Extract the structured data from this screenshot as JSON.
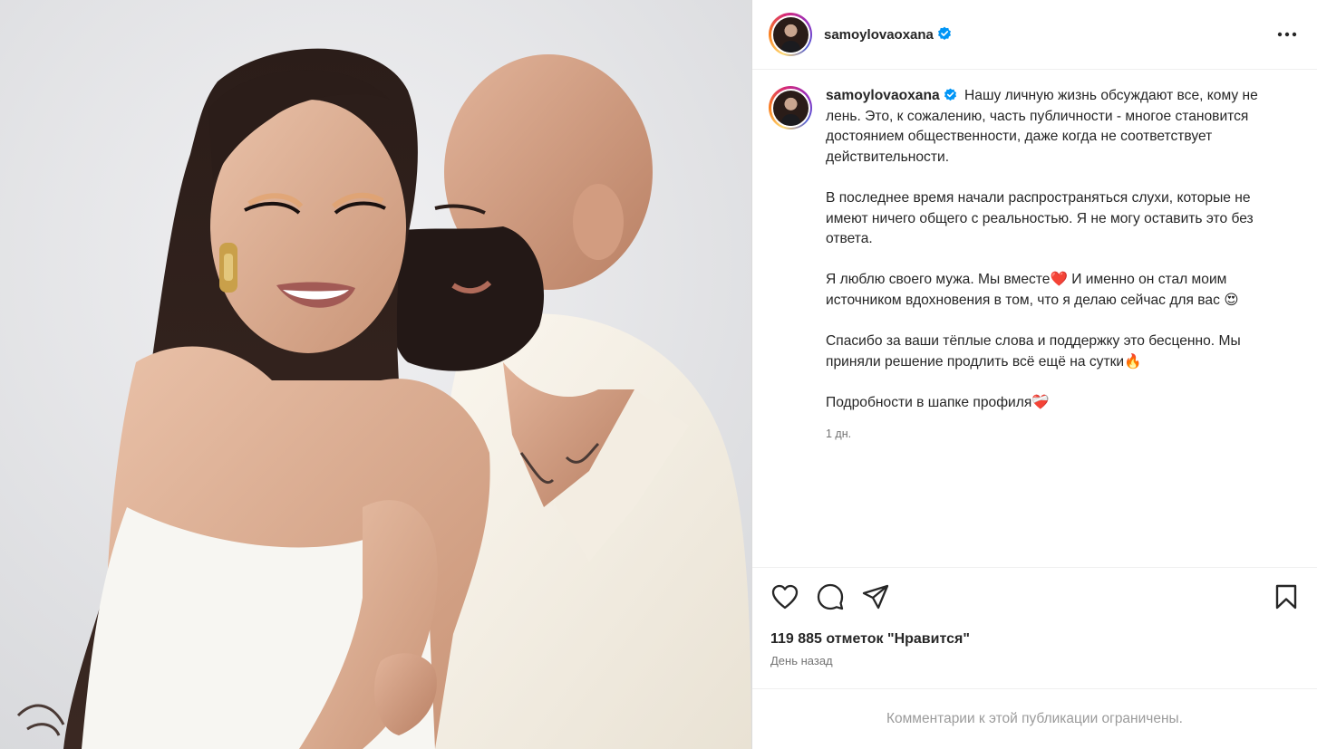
{
  "post": {
    "author": {
      "username": "samoylovaoxana",
      "verified": true,
      "avatar_icon": "profile-photo"
    },
    "caption": {
      "username": "samoylovaoxana",
      "paragraphs": [
        "Нашу личную жизнь обсуждают все, кому не лень. Это, к сожалению, часть публичности - многое становится достоянием общественности, даже когда не соответствует действительности.",
        "В последнее время начали распространяться слухи, которые не имеют ничего общего с реальностью. Я не могу оставить это без ответа.",
        "Я люблю своего мужа. Мы вместе❤️ И именно он стал моим источником вдохновения в том, что я делаю сейчас для вас 😍",
        "Спасибо за ваши тёплые слова и поддержку это бесценно. Мы приняли решение продлить всё ещё на сутки🔥",
        "Подробности в шапке профиля❤️‍🩹"
      ],
      "age": "1 дн."
    },
    "actions": {
      "like_icon": "heart-icon",
      "comment_icon": "comment-icon",
      "share_icon": "share-icon",
      "save_icon": "bookmark-icon"
    },
    "likes": "119 885 отметок \"Нравится\"",
    "posted": "День назад",
    "comments_notice": "Комментарии к этой публикации ограничены.",
    "colors": {
      "verified": "#0095f6",
      "text": "#262626",
      "muted": "#737373"
    }
  }
}
